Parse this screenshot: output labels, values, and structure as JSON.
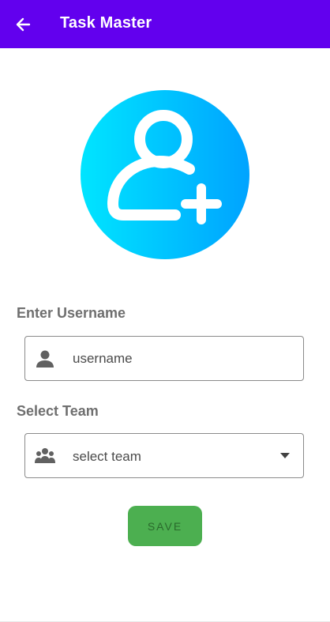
{
  "app_bar": {
    "title": "Task Master",
    "back_icon": "arrow-back-icon",
    "background_color": "#6200ee"
  },
  "hero": {
    "icon": "add-user-icon",
    "gradient_start": "#00e5ff",
    "gradient_end": "#00a3ff"
  },
  "username_section": {
    "label": "Enter Username",
    "icon": "person-icon",
    "placeholder": "username",
    "value": ""
  },
  "team_section": {
    "label": "Select Team",
    "icon": "group-icon",
    "selected_value": "select team",
    "arrow_icon": "dropdown-arrow-icon"
  },
  "actions": {
    "save_label": "SAVE",
    "save_color": "#4caf50"
  }
}
